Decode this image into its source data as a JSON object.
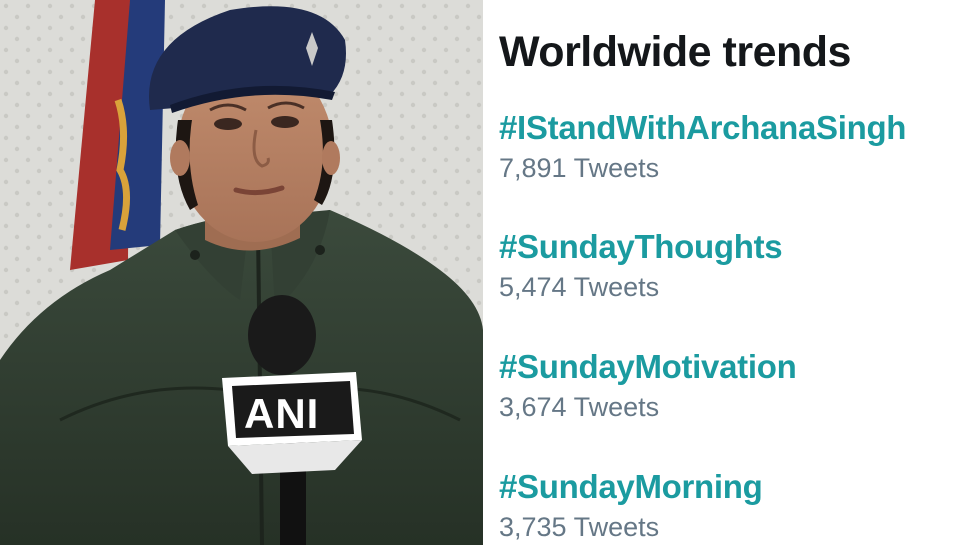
{
  "photo": {
    "mic_flag_text": "ANI"
  },
  "trends_panel": {
    "title": "Worldwide trends",
    "items": [
      {
        "tag": "#IStandWithArchanaSingh",
        "count": "7,891 Tweets"
      },
      {
        "tag": "#SundayThoughts",
        "count": "5,474 Tweets"
      },
      {
        "tag": "#SundayMotivation",
        "count": "3,674 Tweets"
      },
      {
        "tag": "#SundayMorning",
        "count": "3,735 Tweets"
      }
    ],
    "colors": {
      "hashtag": "#1b9ba0",
      "count": "#657786",
      "title": "#14171a"
    }
  }
}
